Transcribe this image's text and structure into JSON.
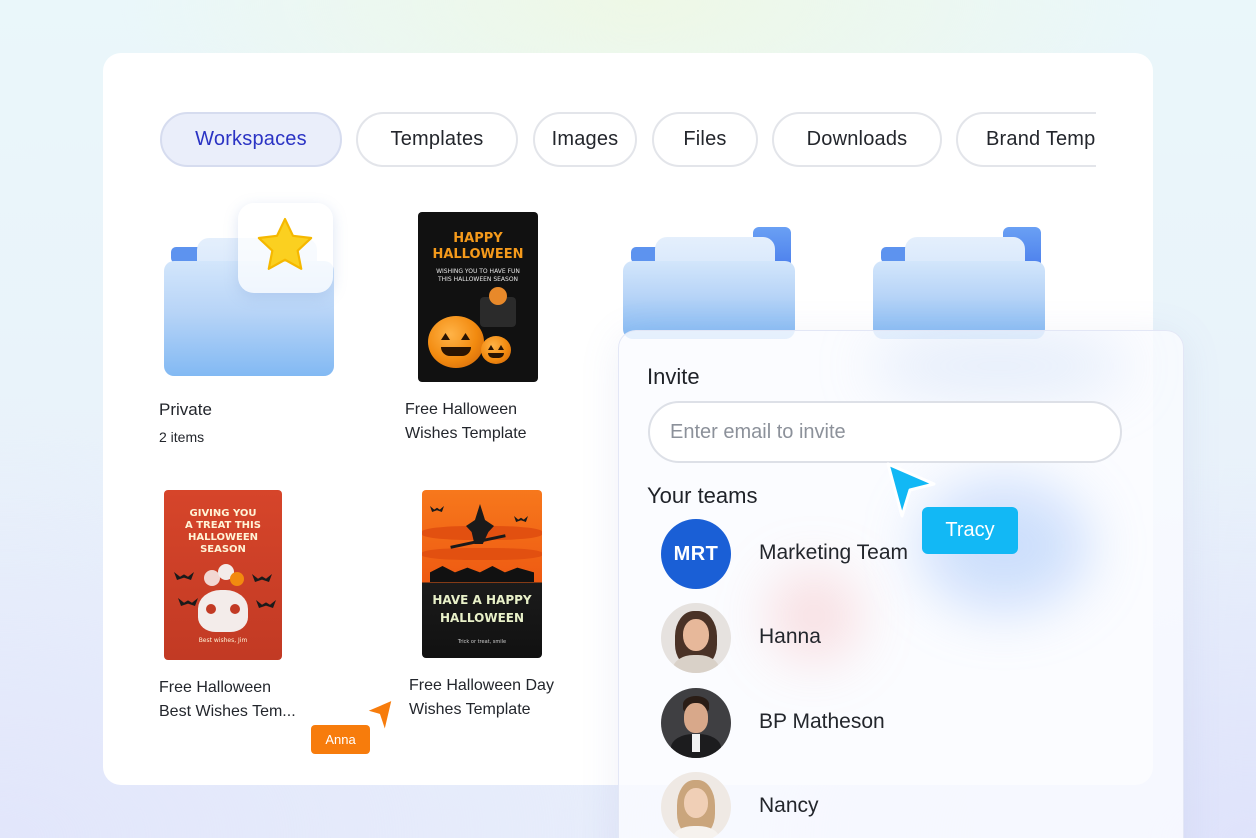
{
  "tabs": [
    {
      "label": "Workspaces",
      "active": true
    },
    {
      "label": "Templates",
      "active": false
    },
    {
      "label": "Images",
      "active": false
    },
    {
      "label": "Files",
      "active": false
    },
    {
      "label": "Downloads",
      "active": false
    },
    {
      "label": "Brand Templates",
      "active": false
    }
  ],
  "items": [
    {
      "title": "Private",
      "subtitle": "2 items",
      "icon": "star-icon"
    },
    {
      "title_line1": "Free Halloween",
      "title_line2": "Wishes Template",
      "thumb_lines": [
        "HAPPY",
        "HALLOWEEN"
      ],
      "thumb_sub": [
        "WISHING YOU TO HAVE FUN",
        "THIS HALLOWEEN SEASON"
      ]
    },
    {
      "title_line1": "Free Halloween",
      "title_line2": "Best Wishes Tem...",
      "thumb_lines": [
        "GIVING YOU",
        "A TREAT THIS",
        "HALLOWEEN",
        "SEASON"
      ],
      "thumb_footer": "Best wishes, Jim"
    },
    {
      "title_line1": "Free Halloween Day",
      "title_line2": "Wishes Template",
      "thumb_lines": [
        "HAVE A HAPPY",
        "HALLOWEEN"
      ],
      "thumb_footer": "Trick or treat, smile"
    }
  ],
  "invite": {
    "heading": "Invite",
    "placeholder": "Enter email to invite",
    "teams_heading": "Your teams",
    "members": [
      {
        "name": "Marketing Team",
        "initials": "MRT"
      },
      {
        "name": "Hanna"
      },
      {
        "name": "BP Matheson"
      },
      {
        "name": "Nancy"
      }
    ]
  },
  "cursors": [
    {
      "name": "Tracy",
      "color": "#12b8f5"
    },
    {
      "name": "Anna",
      "color": "#f77c0c"
    }
  ],
  "colors": {
    "accent": "#2b33c4",
    "team_avatar": "#1a5fd6",
    "folder_blue": "#6da8f0"
  }
}
